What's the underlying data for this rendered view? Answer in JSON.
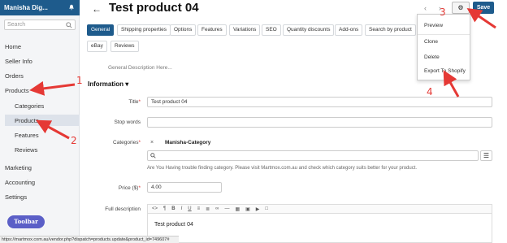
{
  "sidebar": {
    "brand": "Manisha Dig...",
    "search_placeholder": "Search",
    "items": [
      "Home",
      "Seller Info",
      "Orders",
      "Products"
    ],
    "sub_items": [
      "Categories",
      "Products",
      "Features",
      "Reviews"
    ],
    "bottom_items": [
      "Marketing",
      "Accounting",
      "Settings"
    ],
    "toolbar_label": "Toolbar"
  },
  "header": {
    "title": "Test product 04",
    "save_label": "Save"
  },
  "tabs": [
    "General",
    "Shipping properties",
    "Options",
    "Features",
    "Variations",
    "SEO",
    "Quantity discounts",
    "Add-ons",
    "Search by product",
    "eBay",
    "Reviews"
  ],
  "active_tab": "General",
  "general_description": "General Description Here...",
  "section_title": "Information",
  "form": {
    "title_label": "Title",
    "title_value": "Test product 04",
    "stop_words_label": "Stop words",
    "categories_label": "Categories",
    "category_value": "Manisha-Category",
    "category_hint": "Are You Having trouble finding category. Please visit Martmox.com.au and check which category suits better for your product.",
    "price_label": "Price ($)",
    "price_value": "4.00",
    "full_desc_label": "Full description",
    "full_desc_value": "Test product 04"
  },
  "dropdown": [
    "Preview",
    "Clone",
    "Delete",
    "Export To Shopify"
  ],
  "status_url": "https://martmox.com.au/vendor.php?dispatch=products.update&product_id=749607#",
  "annotations": [
    "1",
    "2",
    "3",
    "4"
  ],
  "colors": {
    "brand": "#1e5b8c",
    "annotation": "#e53935",
    "toolbar": "#5b5fc7"
  }
}
